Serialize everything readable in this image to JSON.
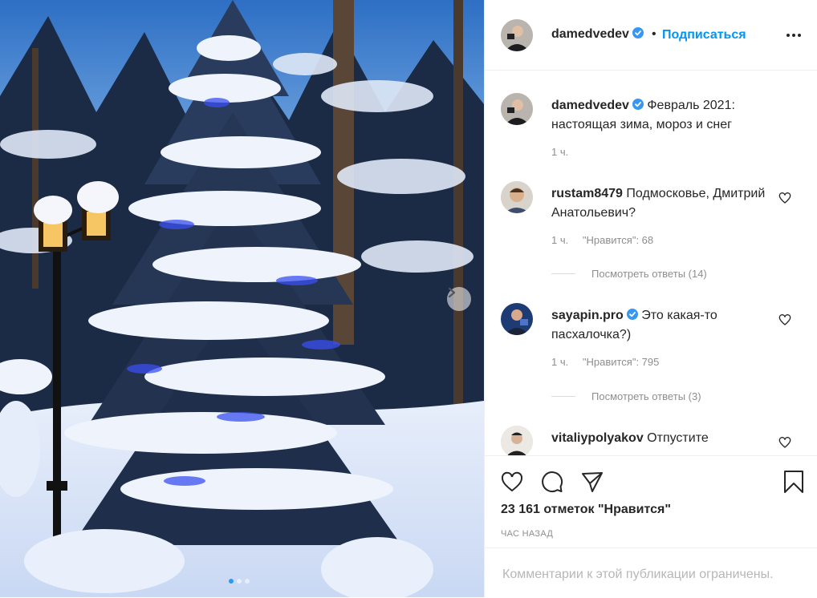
{
  "post": {
    "username": "damedvedev",
    "follow_label": "Подписаться",
    "separator": "•",
    "caption_user": "damedvedev",
    "caption_text": "Февраль 2021: настоящая зима, мороз и снег",
    "caption_time": "1 ч."
  },
  "comments": [
    {
      "user": "rustam8479",
      "text": "Подмосковье, Дмитрий Анатольевич?",
      "time": "1 ч.",
      "likes": "\"Нравится\": 68",
      "replies": "Посмотреть ответы (14)"
    },
    {
      "user": "sayapin.pro",
      "verified": true,
      "text": "Это какая-то пасхалочка?)",
      "time": "1 ч.",
      "likes": "\"Нравится\": 795",
      "replies": "Посмотреть ответы (3)"
    },
    {
      "user": "vitaliypolyakov",
      "text": "Отпустите"
    }
  ],
  "footer": {
    "likes_count": "23 161 отметок \"Нравится\"",
    "posted_time": "Час назад",
    "comments_limited": "Комментарии к этой публикации ограничены."
  },
  "colors": {
    "link": "#0095f6",
    "verified": "#3897f0",
    "text": "#262626",
    "muted": "#8e8e8e"
  },
  "icons": [
    "verified-badge-icon",
    "more-options-icon",
    "heart-icon",
    "comment-icon",
    "share-icon",
    "bookmark-icon",
    "next-arrow-icon"
  ],
  "carousel": {
    "slides": 3,
    "active": 1
  }
}
